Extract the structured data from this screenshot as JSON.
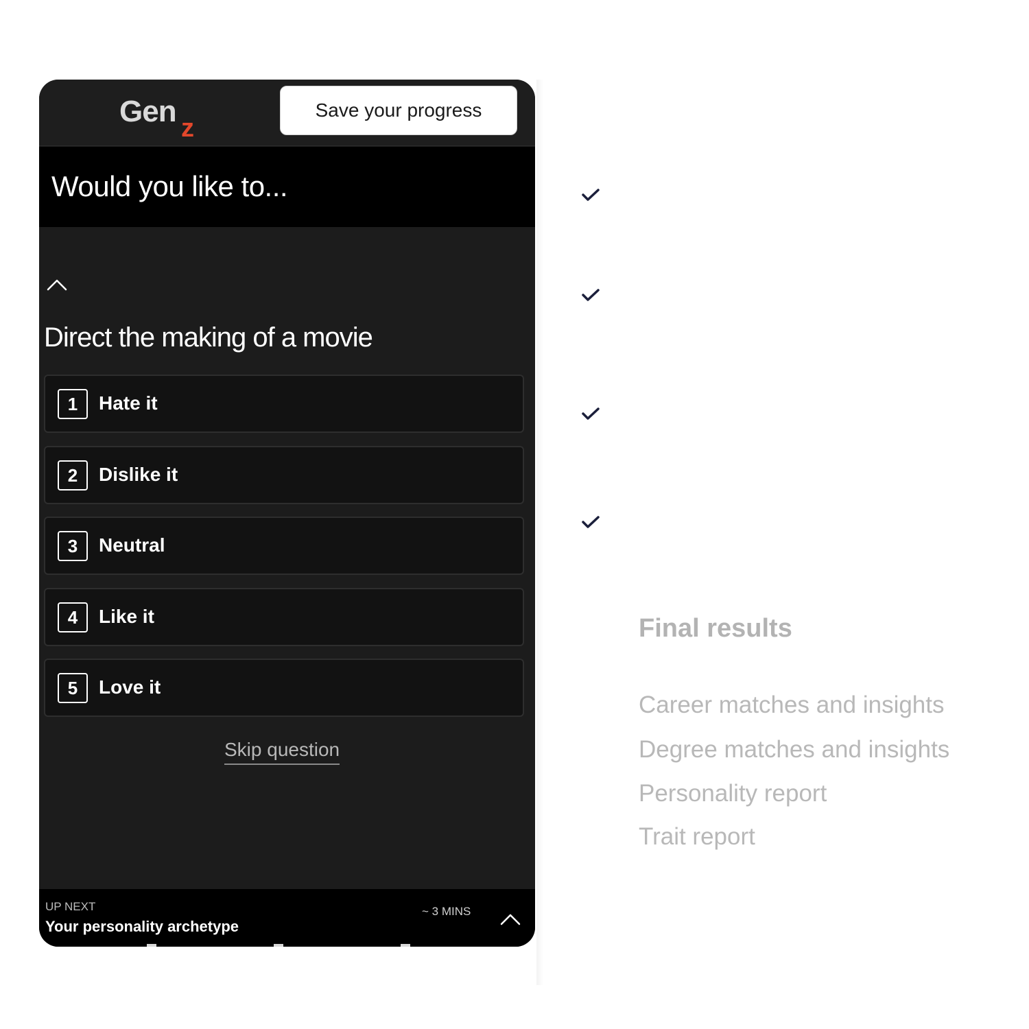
{
  "header": {
    "logo_text": "Gen",
    "logo_sub": "z",
    "save_label": "Save your progress"
  },
  "question": {
    "prompt": "Would you like to...",
    "statement": "Direct the making of a movie",
    "options": [
      {
        "num": "1",
        "label": "Hate it"
      },
      {
        "num": "2",
        "label": "Dislike it"
      },
      {
        "num": "3",
        "label": "Neutral"
      },
      {
        "num": "4",
        "label": "Like it"
      },
      {
        "num": "5",
        "label": "Love it"
      }
    ],
    "skip_label": "Skip question"
  },
  "up_next": {
    "kicker": "UP NEXT",
    "title": "Your personality archetype",
    "duration": "~ 3 MINS"
  },
  "checklist": {
    "checks": 4,
    "check_color": "#1b1f3b"
  },
  "final_results": {
    "title": "Final results",
    "items": [
      "Career matches and insights",
      "Degree matches and insights",
      "Personality report",
      "Trait report"
    ]
  },
  "colors": {
    "phone_bg": "#1c1c1c",
    "header_bg": "#000000",
    "accent": "#e2472b",
    "muted_text": "#b8b8b8"
  }
}
